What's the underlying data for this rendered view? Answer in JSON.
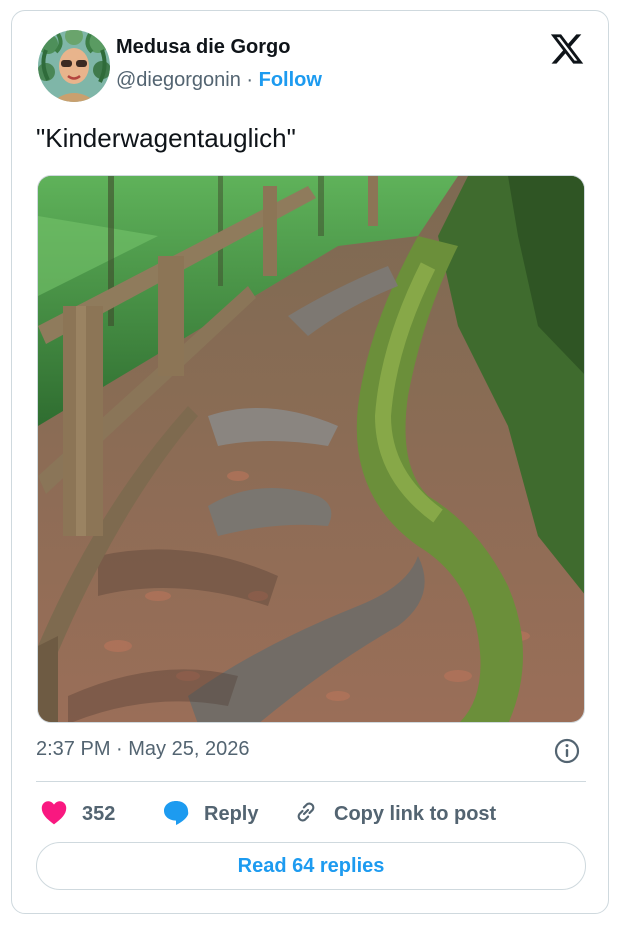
{
  "author": {
    "display_name": "Medusa die Gorgo",
    "handle": "@diegorgonin",
    "separator": "·",
    "follow_label": "Follow"
  },
  "tweet": {
    "text": "\"Kinderwagentauglich\"",
    "timestamp": "2:37 PM · May 25, 2026"
  },
  "actions": {
    "likes_count": "352",
    "reply_label": "Reply",
    "copy_link_label": "Copy link to post"
  },
  "read_replies_label": "Read 64 replies",
  "icons": {
    "brand": "x-logo-icon",
    "like": "heart-icon",
    "reply": "speech-bubble-icon",
    "copy": "link-icon",
    "info": "info-icon"
  },
  "colors": {
    "accent": "#1d9bf0",
    "like": "#f91880",
    "text": "#0f1419",
    "muted": "#536471",
    "border": "#cfd9de"
  }
}
